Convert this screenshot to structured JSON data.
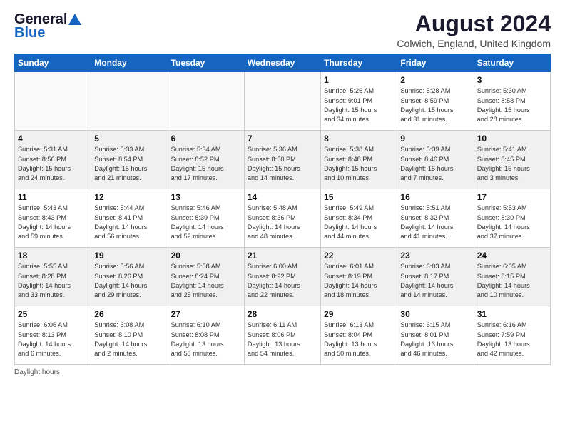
{
  "logo": {
    "line1": "General",
    "line2": "Blue"
  },
  "title": "August 2024",
  "location": "Colwich, England, United Kingdom",
  "days_of_week": [
    "Sunday",
    "Monday",
    "Tuesday",
    "Wednesday",
    "Thursday",
    "Friday",
    "Saturday"
  ],
  "weeks": [
    [
      {
        "num": "",
        "detail": "",
        "empty": true
      },
      {
        "num": "",
        "detail": "",
        "empty": true
      },
      {
        "num": "",
        "detail": "",
        "empty": true
      },
      {
        "num": "",
        "detail": "",
        "empty": true
      },
      {
        "num": "1",
        "detail": "Sunrise: 5:26 AM\nSunset: 9:01 PM\nDaylight: 15 hours\nand 34 minutes."
      },
      {
        "num": "2",
        "detail": "Sunrise: 5:28 AM\nSunset: 8:59 PM\nDaylight: 15 hours\nand 31 minutes."
      },
      {
        "num": "3",
        "detail": "Sunrise: 5:30 AM\nSunset: 8:58 PM\nDaylight: 15 hours\nand 28 minutes."
      }
    ],
    [
      {
        "num": "4",
        "detail": "Sunrise: 5:31 AM\nSunset: 8:56 PM\nDaylight: 15 hours\nand 24 minutes."
      },
      {
        "num": "5",
        "detail": "Sunrise: 5:33 AM\nSunset: 8:54 PM\nDaylight: 15 hours\nand 21 minutes."
      },
      {
        "num": "6",
        "detail": "Sunrise: 5:34 AM\nSunset: 8:52 PM\nDaylight: 15 hours\nand 17 minutes."
      },
      {
        "num": "7",
        "detail": "Sunrise: 5:36 AM\nSunset: 8:50 PM\nDaylight: 15 hours\nand 14 minutes."
      },
      {
        "num": "8",
        "detail": "Sunrise: 5:38 AM\nSunset: 8:48 PM\nDaylight: 15 hours\nand 10 minutes."
      },
      {
        "num": "9",
        "detail": "Sunrise: 5:39 AM\nSunset: 8:46 PM\nDaylight: 15 hours\nand 7 minutes."
      },
      {
        "num": "10",
        "detail": "Sunrise: 5:41 AM\nSunset: 8:45 PM\nDaylight: 15 hours\nand 3 minutes."
      }
    ],
    [
      {
        "num": "11",
        "detail": "Sunrise: 5:43 AM\nSunset: 8:43 PM\nDaylight: 14 hours\nand 59 minutes."
      },
      {
        "num": "12",
        "detail": "Sunrise: 5:44 AM\nSunset: 8:41 PM\nDaylight: 14 hours\nand 56 minutes."
      },
      {
        "num": "13",
        "detail": "Sunrise: 5:46 AM\nSunset: 8:39 PM\nDaylight: 14 hours\nand 52 minutes."
      },
      {
        "num": "14",
        "detail": "Sunrise: 5:48 AM\nSunset: 8:36 PM\nDaylight: 14 hours\nand 48 minutes."
      },
      {
        "num": "15",
        "detail": "Sunrise: 5:49 AM\nSunset: 8:34 PM\nDaylight: 14 hours\nand 44 minutes."
      },
      {
        "num": "16",
        "detail": "Sunrise: 5:51 AM\nSunset: 8:32 PM\nDaylight: 14 hours\nand 41 minutes."
      },
      {
        "num": "17",
        "detail": "Sunrise: 5:53 AM\nSunset: 8:30 PM\nDaylight: 14 hours\nand 37 minutes."
      }
    ],
    [
      {
        "num": "18",
        "detail": "Sunrise: 5:55 AM\nSunset: 8:28 PM\nDaylight: 14 hours\nand 33 minutes."
      },
      {
        "num": "19",
        "detail": "Sunrise: 5:56 AM\nSunset: 8:26 PM\nDaylight: 14 hours\nand 29 minutes."
      },
      {
        "num": "20",
        "detail": "Sunrise: 5:58 AM\nSunset: 8:24 PM\nDaylight: 14 hours\nand 25 minutes."
      },
      {
        "num": "21",
        "detail": "Sunrise: 6:00 AM\nSunset: 8:22 PM\nDaylight: 14 hours\nand 22 minutes."
      },
      {
        "num": "22",
        "detail": "Sunrise: 6:01 AM\nSunset: 8:19 PM\nDaylight: 14 hours\nand 18 minutes."
      },
      {
        "num": "23",
        "detail": "Sunrise: 6:03 AM\nSunset: 8:17 PM\nDaylight: 14 hours\nand 14 minutes."
      },
      {
        "num": "24",
        "detail": "Sunrise: 6:05 AM\nSunset: 8:15 PM\nDaylight: 14 hours\nand 10 minutes."
      }
    ],
    [
      {
        "num": "25",
        "detail": "Sunrise: 6:06 AM\nSunset: 8:13 PM\nDaylight: 14 hours\nand 6 minutes."
      },
      {
        "num": "26",
        "detail": "Sunrise: 6:08 AM\nSunset: 8:10 PM\nDaylight: 14 hours\nand 2 minutes."
      },
      {
        "num": "27",
        "detail": "Sunrise: 6:10 AM\nSunset: 8:08 PM\nDaylight: 13 hours\nand 58 minutes."
      },
      {
        "num": "28",
        "detail": "Sunrise: 6:11 AM\nSunset: 8:06 PM\nDaylight: 13 hours\nand 54 minutes."
      },
      {
        "num": "29",
        "detail": "Sunrise: 6:13 AM\nSunset: 8:04 PM\nDaylight: 13 hours\nand 50 minutes."
      },
      {
        "num": "30",
        "detail": "Sunrise: 6:15 AM\nSunset: 8:01 PM\nDaylight: 13 hours\nand 46 minutes."
      },
      {
        "num": "31",
        "detail": "Sunrise: 6:16 AM\nSunset: 7:59 PM\nDaylight: 13 hours\nand 42 minutes."
      }
    ]
  ],
  "footer": "Daylight hours"
}
